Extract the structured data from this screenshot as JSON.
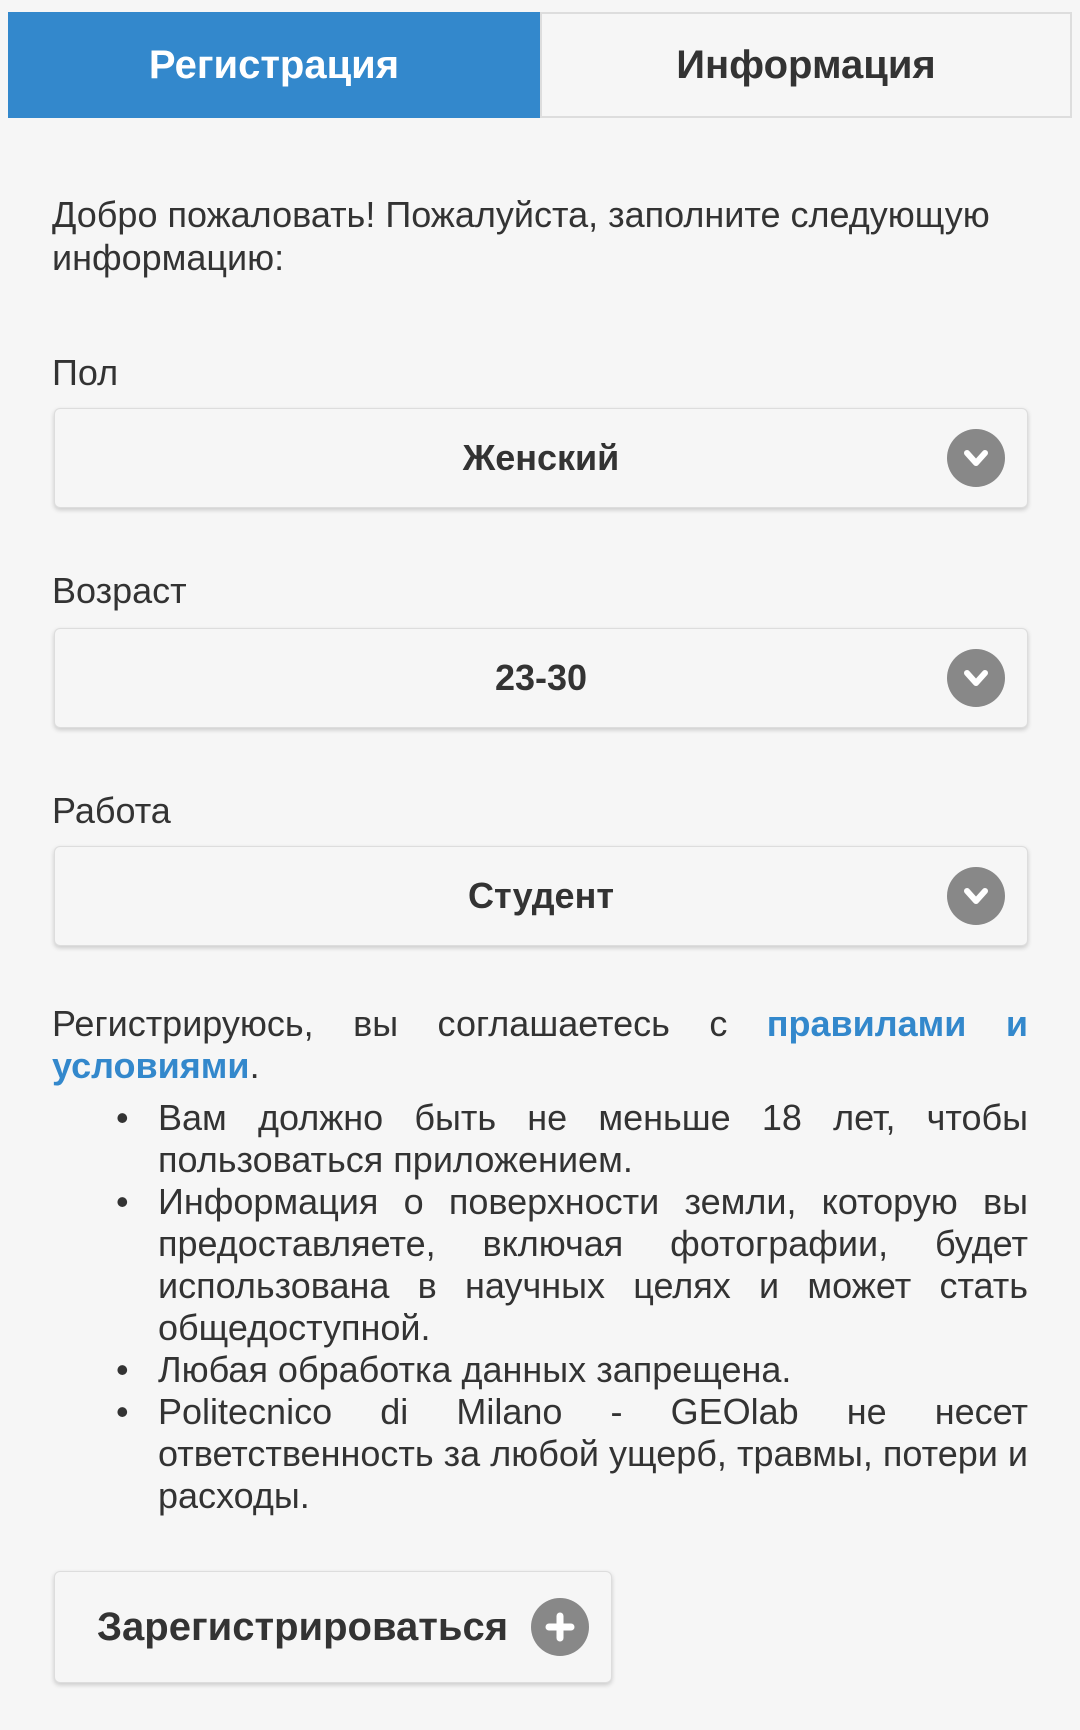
{
  "tabs": [
    {
      "label": "Регистрация",
      "active": true
    },
    {
      "label": "Информация",
      "active": false
    }
  ],
  "intro": "Добро пожаловать! Пожалуйста, заполните следующую информацию:",
  "fields": {
    "gender": {
      "label": "Пол",
      "value": "Женский"
    },
    "age": {
      "label": "Возраст",
      "value": "23-30"
    },
    "job": {
      "label": "Работа",
      "value": "Студент"
    }
  },
  "terms": {
    "prefix": "Регистрируюсь, вы соглашаетесь с ",
    "link": "правилами и условиями",
    "suffix": ".",
    "bullets": [
      "Вам должно быть не меньше 18 лет, чтобы пользоваться приложением.",
      "Информация о поверхности земли, которую вы предоставляете, включая фотографии, будет использована в научных целях и может стать общедоступной.",
      "Любая обработка данных запрещена.",
      "Politecnico di Milano - GEOlab не несет ответственность за любой ущерб, травмы, потери и расходы."
    ]
  },
  "register_button": {
    "label": "Зарегистрироваться"
  },
  "colors": {
    "accent": "#3388cc",
    "icon_bg": "#888888",
    "background": "#f6f6f6"
  },
  "icons": {
    "select": "chevron-down-icon",
    "button": "plus-icon",
    "bullet": "•"
  }
}
